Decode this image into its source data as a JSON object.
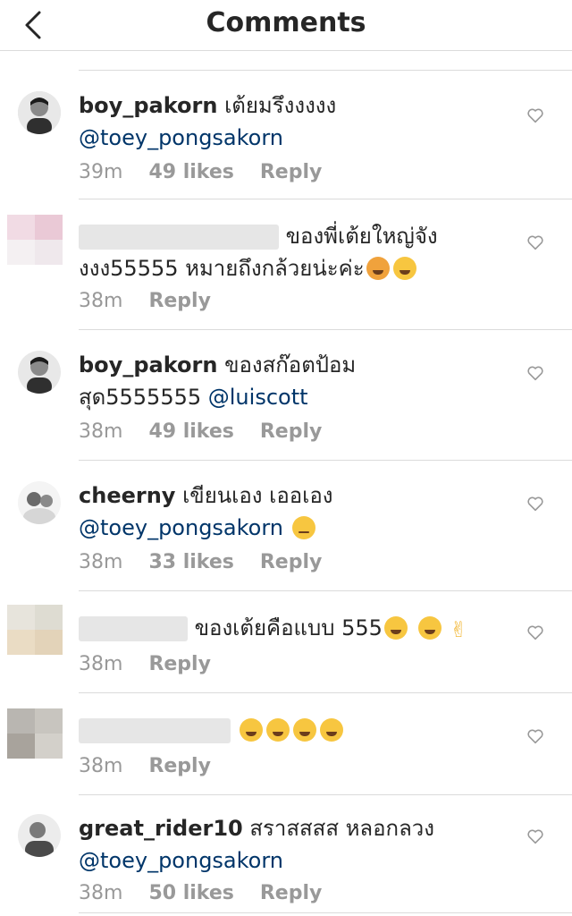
{
  "header": {
    "title": "Comments"
  },
  "comments": [
    {
      "username": "boy_pakorn",
      "text": "เต้ยมรึงงงงง",
      "mention": "@toey_pongsakorn",
      "time": "39m",
      "likes": "49 likes",
      "reply": "Reply"
    },
    {
      "text1": "ของพี่เต้ยใหญ่จัง",
      "text2": "งงง55555 หมายถึงกล้วยน่ะค่ะ",
      "time": "38m",
      "reply": "Reply"
    },
    {
      "username": "boy_pakorn",
      "text": "ของสก๊อตป้อม",
      "line2": "สุด5555555",
      "mention": "@luiscott",
      "time": "38m",
      "likes": "49 likes",
      "reply": "Reply"
    },
    {
      "username": "cheerny",
      "text": "เขียนเอง เออเอง",
      "mention": "@toey_pongsakorn",
      "time": "38m",
      "likes": "33 likes",
      "reply": "Reply"
    },
    {
      "text": "ของเต้ยคือแบบ 555",
      "time": "38m",
      "reply": "Reply"
    },
    {
      "time": "38m",
      "reply": "Reply"
    },
    {
      "username": "great_rider10",
      "text": "สราสสสส หลอกลวง",
      "mention": "@toey_pongsakorn",
      "time": "38m",
      "likes": "50 likes",
      "reply": "Reply"
    }
  ],
  "icons": {
    "back": "chevron-left-icon",
    "like": "heart-outline-icon"
  },
  "colors": {
    "text": "#262626",
    "mention": "#003569",
    "meta": "#999999",
    "divider": "#dbdbdb"
  }
}
